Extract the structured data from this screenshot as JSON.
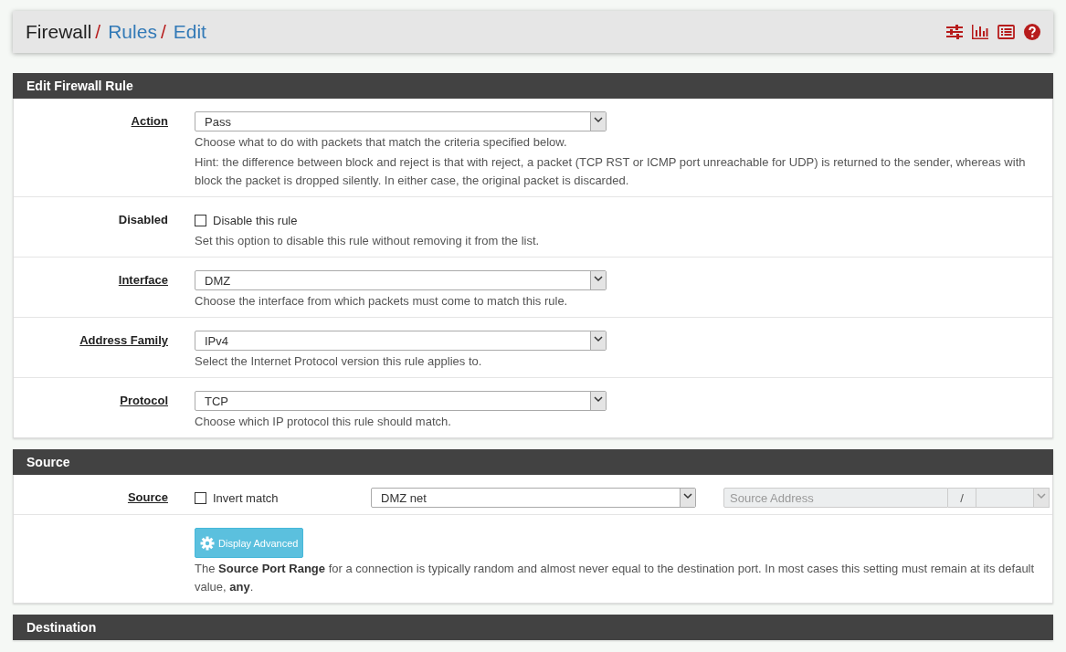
{
  "breadcrumb": [
    {
      "label": "Firewall",
      "link": false,
      "separator": "/"
    },
    {
      "label": "Rules",
      "link": true,
      "separator": "/"
    },
    {
      "label": "Edit",
      "link": true
    }
  ],
  "sections": [
    {
      "title": "Edit Firewall Rule",
      "rows": [
        {
          "kind": "select",
          "label": "Action",
          "required": true,
          "value": "Pass",
          "help": [
            "Choose what to do with packets that match the criteria specified below.",
            "Hint: the difference between block and reject is that with reject, a packet (TCP RST or ICMP port unreachable for UDP) is returned to the sender, whereas with block the packet is dropped silently. In either case, the original packet is discarded."
          ]
        },
        {
          "kind": "checkbox",
          "label": "Disabled",
          "required": false,
          "checkbox": {
            "label": "Disable this rule",
            "checked": false
          },
          "help": [
            "Set this option to disable this rule without removing it from the list."
          ]
        },
        {
          "kind": "select",
          "label": "Interface",
          "required": true,
          "value": "DMZ",
          "help": [
            "Choose the interface from which packets must come to match this rule."
          ]
        },
        {
          "kind": "select",
          "label": "Address Family",
          "required": true,
          "value": "IPv4",
          "help": [
            "Select the Internet Protocol version this rule applies to."
          ]
        },
        {
          "kind": "select",
          "label": "Protocol",
          "required": true,
          "value": "TCP",
          "help": [
            "Choose which IP protocol this rule should match."
          ]
        }
      ]
    },
    {
      "title": "Source",
      "rows": [
        {
          "kind": "source",
          "label": "Source",
          "required": true,
          "checkbox": {
            "label": "Invert match",
            "checked": false
          },
          "value": "DMZ net",
          "address": {
            "placeholder": "Source Address",
            "separator": "/",
            "disabled": true
          }
        },
        {
          "kind": "advanced",
          "button": "Display Advanced",
          "help": [
            "The **Source Port Range** for a connection is typically random and almost never equal to the destination port. In most cases this setting must remain at its default value, **any**."
          ]
        }
      ]
    },
    {
      "title": "Destination"
    }
  ]
}
